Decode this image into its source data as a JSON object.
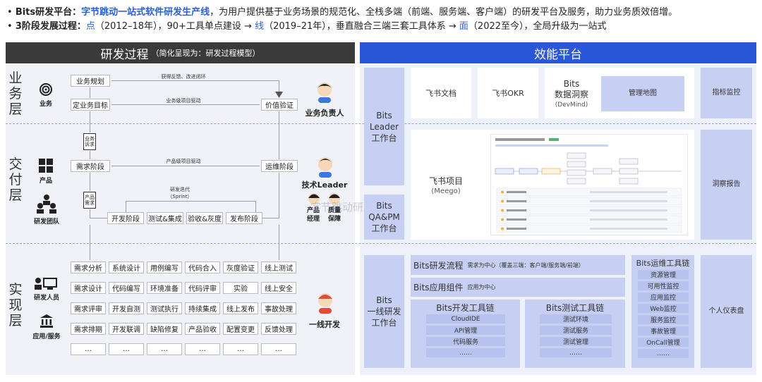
{
  "intro": {
    "line1_label": "Bits研发平台：",
    "line1_highlight": "字节跳动一站式软件研发生产线",
    "line1_rest": "，为用户提供基于业务场景的规范化、全栈多端（前端、服务端、客户端）的研发平台及服务，助力业务质效倍增。",
    "line2_label": "3阶段发展过程：",
    "p1": "点",
    "p1_rest": "（2012–18年），90+工具单点建设 → ",
    "p2": "线",
    "p2_rest": "（2019–21年），垂直融合三端三套工具体系 → ",
    "p3": "面",
    "p3_rest": "（2022至今），全局升级为一站式"
  },
  "left_header": {
    "title": "研发过程",
    "note": "（简化呈现为：研发过程模型）"
  },
  "right_header": {
    "title": "效能平台"
  },
  "layers": {
    "business": "业务层",
    "delivery": "交付层",
    "impl": "实现层"
  },
  "icons": {
    "business": "业务",
    "product": "产品",
    "team": "研发团队",
    "devs": "研发人员",
    "apps": "应用/服务"
  },
  "people": {
    "biz_owner": "业务负责人",
    "tech_leader": "技术Leader",
    "pm": "产品\n经理",
    "qa": "质量\n保障",
    "frontline": "一线开发"
  },
  "process": {
    "biz_plan": "业务规划",
    "biz_goal": "定业务目标",
    "value_verify": "价值验证",
    "feedback": "获得反馈、改进闭环",
    "biz_drive": "业务级项目驱动",
    "biz_req": "业务\n诉求",
    "req_stage": "需求阶段",
    "ops_stage": "运维阶段",
    "product_drive": "产品级项目驱动",
    "prod_req": "产品\n需求",
    "iter": "研发迭代",
    "sprint": "（Sprint）",
    "dev_stage": "开发阶段",
    "test_int": "测试&集成",
    "accept": "验收&灰度",
    "release": "发布阶段"
  },
  "impl_grid": [
    [
      "需求分析",
      "系统设计",
      "用例编写",
      "代码合入",
      "灰度验证",
      "线上测试"
    ],
    [
      "需求设计",
      "代码编写",
      "环境准备",
      "代码评审",
      "实验",
      "线上安全"
    ],
    [
      "需求评审",
      "开发自测",
      "测试执行",
      "持续集成",
      "线上发布",
      "事故处理"
    ],
    [
      "需求排期",
      "开发联调",
      "缺陷修复",
      "产品验收",
      "配置变更",
      "反馈处理"
    ],
    [
      "…",
      "…",
      "…",
      "…",
      "…",
      "…"
    ]
  ],
  "platform": {
    "leader_wb": "Bits\nLeader\n工作台",
    "qapm_wb": "Bits\nQA&PM\n工作台",
    "dev_wb": "Bits\n一线研发\n工作台",
    "feishu_doc": "飞书文档",
    "feishu_okr": "飞书OKR",
    "devmind_title": "Bits\n数据洞察",
    "devmind_sub": "(DevMind)",
    "mgmt_map": "管理地图",
    "metric_monitor": "指标监控",
    "insight_report": "洞察报告",
    "personal_dash": "个人仪表盘",
    "meego_title": "飞书项目",
    "meego_sub": "(Meego)",
    "dev_flow_title": "Bits研发流程",
    "dev_flow_note": "需求为中心（覆盖三端：客户端/服务端/前端）",
    "app_comp_title": "Bits应用组件",
    "app_comp_note": "应用为中心",
    "devtools_title": "Bits开发工具链",
    "devtools": [
      "CloudIDE",
      "API管理",
      "代码服务",
      "……"
    ],
    "testtools_title": "Bits测试工具链",
    "testtools": [
      "测试环境",
      "测试服务",
      "测试管理",
      "……"
    ],
    "opstools_title": "Bits运维工具链",
    "opstools": [
      "资源管理",
      "可用性监控",
      "应用监控",
      "Web监控",
      "服务监控",
      "事故管理",
      "OnCall管理",
      "……"
    ]
  },
  "watermark": "字节跳动研发效能"
}
